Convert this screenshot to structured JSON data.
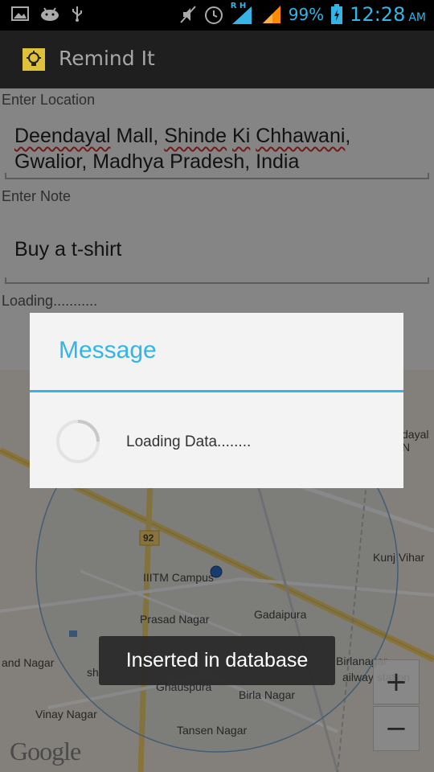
{
  "status_bar": {
    "signal_label": "R H",
    "battery_percent": "99%",
    "time": "12:28",
    "ampm": "AM",
    "icons": [
      "picture-icon",
      "android-icon",
      "usb-icon",
      "mute-icon",
      "alarm-icon",
      "signal-icon",
      "signal-icon-2",
      "battery-icon"
    ]
  },
  "action_bar": {
    "title": "Remind It",
    "icon": "lightbulb-icon"
  },
  "form": {
    "location_label": "Enter Location",
    "location_value_line1_parts": [
      "Deendayal",
      " Mall, ",
      "Shinde",
      " ",
      "Ki",
      " ",
      "Chhawani",
      ","
    ],
    "location_value_line2": "Gwalior, Madhya Pradesh, India",
    "note_label": "Enter Note",
    "note_value": "Buy a t-shirt",
    "status_text": "Loading..........."
  },
  "map": {
    "labels": {
      "road_number": "92",
      "campus": "IIITM Campus",
      "prasad_nagar": "Prasad Nagar",
      "gadaipura": "Gadaipura",
      "kunj_vihar": "Kunj Vihar",
      "and_nagar": "and Nagar",
      "sh": "sh",
      "ghauspura": "Ghauspura",
      "birla_nagar": "Birla Nagar",
      "birlanagar_railway": "Birlanagar",
      "railway_station": "ailway station",
      "vinay_nagar": "Vinay Nagar",
      "tansen_nagar": "Tansen Nagar",
      "dayal": "dayal N",
      "google": "Google"
    },
    "zoom_in": "+",
    "zoom_out": "−"
  },
  "dialog": {
    "title": "Message",
    "message": "Loading Data........"
  },
  "toast": {
    "text": "Inserted in database"
  },
  "colors": {
    "accent": "#33b5e5",
    "actionbar": "#1f1f1f",
    "status_bar": "#000000"
  }
}
